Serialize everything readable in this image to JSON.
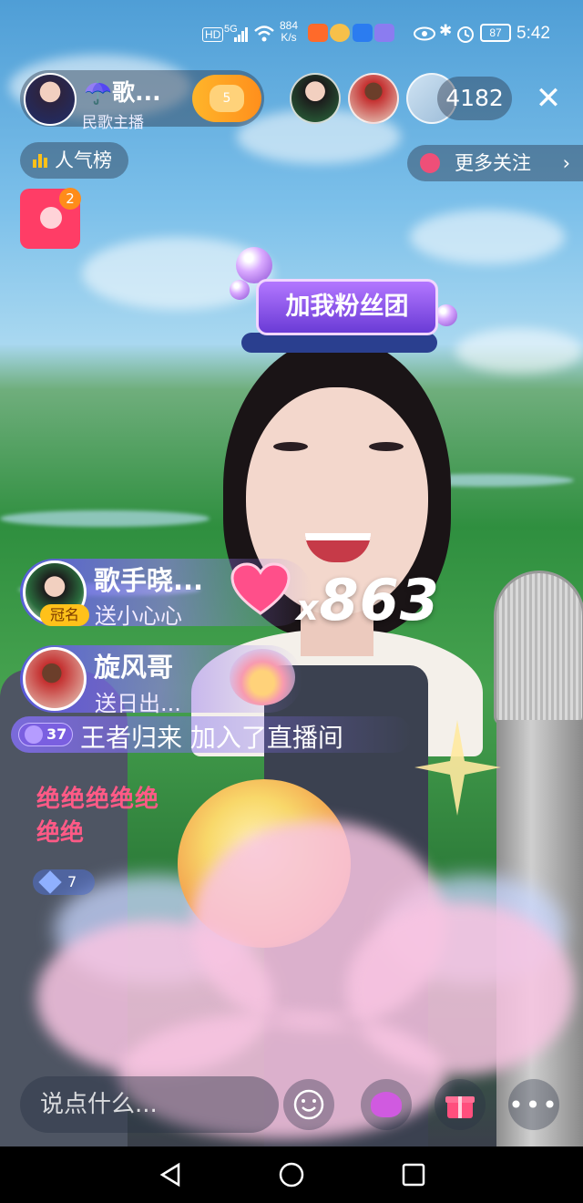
{
  "status_bar": {
    "hd": "HD",
    "signal": "5G",
    "net_speed_value": "884",
    "net_speed_unit": "K/s",
    "battery": "87",
    "time": "5:42"
  },
  "host": {
    "name": "☂️歌...",
    "subtitle": "民歌主播",
    "follow_badge": "5"
  },
  "viewer_count": "4182",
  "close_label": "✕",
  "popularity_rank": "人气榜",
  "more_follow": "更多关注",
  "red_packet_badge": "2",
  "fan_club_banner": "加我粉丝团",
  "gifts": [
    {
      "name": "歌手晓...",
      "action": "送小心心",
      "tag": "冠名"
    },
    {
      "name": "旋风哥",
      "action": "送日出..."
    }
  ],
  "combo": {
    "prefix": "x",
    "count": "863"
  },
  "join_notice": {
    "level": "37",
    "text": "王者归来 加入了直播间"
  },
  "chat_lines": [
    "绝绝绝绝绝",
    "绝绝"
  ],
  "second_level": "7",
  "input_placeholder": "说点什么...",
  "colors": {
    "accent": "#ff8f1c",
    "gift_purple": "#5a5ae6",
    "chat_pink": "#ff5a86"
  }
}
